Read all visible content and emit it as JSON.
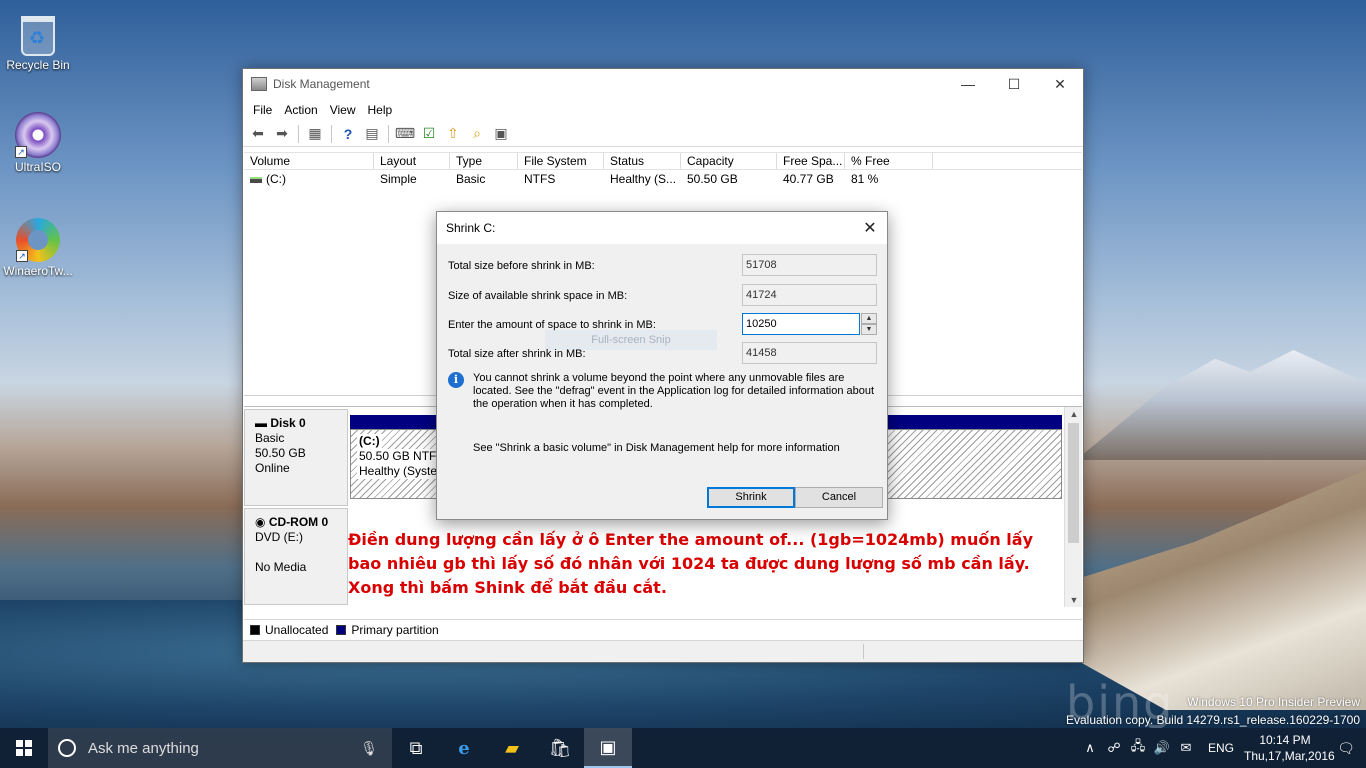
{
  "desktop": {
    "icons": [
      {
        "label": "Recycle Bin"
      },
      {
        "label": "UltraISO"
      },
      {
        "label": "WinaeroTw..."
      }
    ],
    "watermark_line1": "Windows 10 Pro Insider Preview",
    "watermark_line2": "Evaluation copy. Build 14279.rs1_release.160229-1700",
    "bing_text": "bing"
  },
  "window": {
    "title": "Disk Management",
    "menu": [
      "File",
      "Action",
      "View",
      "Help"
    ],
    "volume_columns": [
      "Volume",
      "Layout",
      "Type",
      "File System",
      "Status",
      "Capacity",
      "Free Spa...",
      "% Free"
    ],
    "volumes": [
      {
        "volume": "(C:)",
        "layout": "Simple",
        "type": "Basic",
        "fs": "NTFS",
        "status": "Healthy (S...",
        "capacity": "50.50 GB",
        "free": "40.77 GB",
        "pct_free": "81 %"
      }
    ],
    "disk0": {
      "name": "Disk 0",
      "type": "Basic",
      "size": "50.50 GB",
      "state": "Online"
    },
    "partition_c": {
      "label": "(C:)",
      "info": "50.50 GB NTFS",
      "status": "Healthy (System"
    },
    "cdrom": {
      "name": "CD-ROM 0",
      "drive": "DVD (E:)",
      "media": "No Media"
    },
    "legend": {
      "unallocated": "Unallocated",
      "primary": "Primary partition"
    },
    "colors": {
      "unallocated": "#000000",
      "primary": "#000080"
    }
  },
  "annotation": "Điền dung lượng cần lấy ở ô Enter the amount of... (1gb=1024mb) muốn lấy bao nhiêu gb thì lấy số đó nhân với 1024 ta được dung lượng số mb cần lấy. Xong thì bấm Shink để bắt đầu cắt.",
  "dialog": {
    "title": "Shrink C:",
    "total_before_label": "Total size before shrink in MB:",
    "total_before_value": "51708",
    "available_label": "Size of available shrink space in MB:",
    "available_value": "41724",
    "amount_label": "Enter the amount of space to shrink in MB:",
    "amount_value": "10250",
    "total_after_label": "Total size after shrink in MB:",
    "total_after_value": "41458",
    "info_text": "You cannot shrink a volume beyond the point where any unmovable files are located. See the \"defrag\" event in the Application log for detailed information about the operation when it has completed.",
    "help_text": "See \"Shrink a basic volume\" in Disk Management help for more information",
    "shrink_label": "Shrink",
    "cancel_label": "Cancel",
    "snip_overlay": "Full-screen Snip"
  },
  "taskbar": {
    "search_placeholder": "Ask me anything",
    "language": "ENG",
    "time": "10:14 PM",
    "date": "Thu,17,Mar,2016"
  }
}
